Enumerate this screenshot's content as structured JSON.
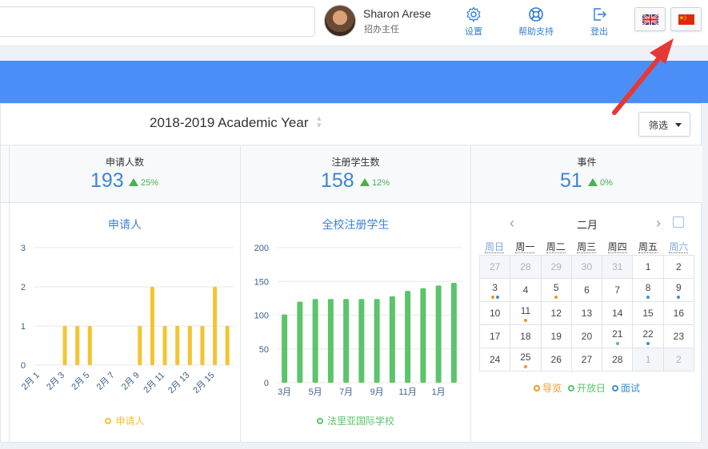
{
  "header": {
    "search_value": "",
    "user_name": "Sharon Arese",
    "user_role": "招办主任",
    "settings_label": "设置",
    "help_label": "帮助支持",
    "logout_label": "登出",
    "languages": [
      "english",
      "chinese"
    ],
    "accent_color": "#2f7fd8"
  },
  "toolbar": {
    "academic_year": "2018-2019 Academic Year",
    "filter_label": "筛选"
  },
  "stats": [
    {
      "label": "申请人数",
      "value": "193",
      "delta": "25%"
    },
    {
      "label": "注册学生数",
      "value": "158",
      "delta": "12%"
    },
    {
      "label": "事件",
      "value": "51",
      "delta": "0%"
    }
  ],
  "chart_data": [
    {
      "type": "bar",
      "title": "申请人",
      "color": "#f4c430",
      "ylim": [
        0,
        3
      ],
      "yticks": [
        "0",
        "1",
        "2",
        "3"
      ],
      "xtick_labels": [
        "2月 1",
        "2月 3",
        "2月 5",
        "2月 7",
        "2月 9",
        "2月 11",
        "2月 13",
        "2月 15"
      ],
      "categories": [
        "2月 1",
        "2月 2",
        "2月 3",
        "2月 4",
        "2月 5",
        "2月 6",
        "2月 7",
        "2月 8",
        "2月 9",
        "2月 10",
        "2月 11",
        "2月 12",
        "2月 13",
        "2月 14",
        "2月 15",
        "2月 16"
      ],
      "series": [
        {
          "name": "申请人",
          "values": [
            0,
            0,
            1,
            1,
            1,
            0,
            0,
            0,
            1,
            2,
            1,
            1,
            1,
            1,
            2,
            1
          ]
        }
      ],
      "legend_label": "申请人",
      "grid": true
    },
    {
      "type": "bar",
      "title": "全校注册学生",
      "color": "#5cc46a",
      "ylim": [
        0,
        200
      ],
      "yticks": [
        "0",
        "50",
        "100",
        "150",
        "200"
      ],
      "xtick_labels": [
        "3月",
        "5月",
        "7月",
        "9月",
        "11月",
        "1月"
      ],
      "categories": [
        "3月",
        "4月",
        "5月",
        "6月",
        "7月",
        "8月",
        "9月",
        "10月",
        "11月",
        "12月",
        "1月",
        "2月"
      ],
      "series": [
        {
          "name": "法里亚国际学校",
          "values": [
            101,
            120,
            124,
            124,
            124,
            124,
            124,
            128,
            136,
            140,
            144,
            148
          ]
        }
      ],
      "legend_label": "法里亚国际学校",
      "grid": true
    }
  ],
  "calendar": {
    "month": "二月",
    "weekdays": [
      "周日",
      "周一",
      "周二",
      "周三",
      "周四",
      "周五",
      "周六"
    ],
    "weeks": [
      [
        {
          "d": "27",
          "off": true,
          "m": []
        },
        {
          "d": "28",
          "off": true,
          "m": []
        },
        {
          "d": "29",
          "off": true,
          "m": []
        },
        {
          "d": "30",
          "off": true,
          "m": []
        },
        {
          "d": "31",
          "off": true,
          "m": []
        },
        {
          "d": "1",
          "m": []
        },
        {
          "d": "2",
          "m": []
        }
      ],
      [
        {
          "d": "3",
          "m": [
            "o",
            "b"
          ]
        },
        {
          "d": "4",
          "m": []
        },
        {
          "d": "5",
          "m": [
            "o"
          ]
        },
        {
          "d": "6",
          "m": []
        },
        {
          "d": "7",
          "m": []
        },
        {
          "d": "8",
          "m": [
            "b"
          ]
        },
        {
          "d": "9",
          "m": [
            "b"
          ]
        }
      ],
      [
        {
          "d": "10",
          "m": []
        },
        {
          "d": "11",
          "m": [
            "o"
          ]
        },
        {
          "d": "12",
          "m": []
        },
        {
          "d": "13",
          "m": []
        },
        {
          "d": "14",
          "m": []
        },
        {
          "d": "15",
          "m": []
        },
        {
          "d": "16",
          "m": []
        }
      ],
      [
        {
          "d": "17",
          "m": []
        },
        {
          "d": "18",
          "m": []
        },
        {
          "d": "19",
          "m": []
        },
        {
          "d": "20",
          "m": []
        },
        {
          "d": "21",
          "m": [
            "g"
          ]
        },
        {
          "d": "22",
          "m": [
            "b"
          ]
        },
        {
          "d": "23",
          "m": []
        }
      ],
      [
        {
          "d": "24",
          "m": []
        },
        {
          "d": "25",
          "m": [
            "o"
          ]
        },
        {
          "d": "26",
          "m": []
        },
        {
          "d": "27",
          "m": []
        },
        {
          "d": "28",
          "m": []
        },
        {
          "d": "1",
          "off": true,
          "m": []
        },
        {
          "d": "2",
          "off": true,
          "m": []
        }
      ]
    ],
    "legend": [
      {
        "label": "导览",
        "color": "#f0962c"
      },
      {
        "label": "开放日",
        "color": "#5cc46a"
      },
      {
        "label": "面试",
        "color": "#3d8fd1"
      }
    ],
    "mark_colors": {
      "o": "#f0962c",
      "g": "#5cc46a",
      "b": "#3d8fd1"
    }
  },
  "colors": {
    "banner": "#4c8ef7",
    "stat_value": "#3d85d8",
    "positive": "#4caf50",
    "annotation_arrow": "#e53935"
  }
}
